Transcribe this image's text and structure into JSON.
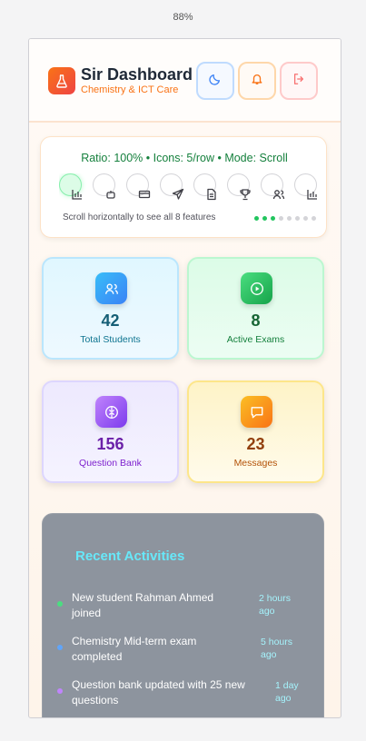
{
  "zoom": "88%",
  "header": {
    "title": "Sir Dashboard",
    "subtitle": "Chemistry & ICT Care",
    "buttons": [
      {
        "name": "theme-toggle",
        "icon": "moon-icon"
      },
      {
        "name": "notifications",
        "icon": "bell-icon"
      },
      {
        "name": "logout",
        "icon": "logout-icon"
      }
    ]
  },
  "features": {
    "status": "Ratio: 100% • Icons: 5/row • Mode: Scroll",
    "hint": "Scroll horizontally to see all 8 features",
    "icons": [
      "chart-icon",
      "robot-icon",
      "card-icon",
      "send-icon",
      "document-icon",
      "trophy-icon",
      "users-icon",
      "chart-icon"
    ],
    "active_index": 0,
    "pagination": {
      "total": 8,
      "active": 3
    }
  },
  "stats": [
    {
      "value": "42",
      "label": "Total Students",
      "icon": "users-icon",
      "color": "#0e7490"
    },
    {
      "value": "8",
      "label": "Active Exams",
      "icon": "play-icon",
      "color": "#15803d"
    },
    {
      "value": "156",
      "label": "Question Bank",
      "icon": "brain-icon",
      "color": "#7e22ce"
    },
    {
      "value": "23",
      "label": "Messages",
      "icon": "message-icon",
      "color": "#b45309"
    }
  ],
  "activities": {
    "title": "Recent Activities",
    "items": [
      {
        "text": "New student Rahman Ahmed joined",
        "time": "2 hours ago",
        "color": "#4ade80"
      },
      {
        "text": "Chemistry Mid-term exam completed",
        "time": "5 hours ago",
        "color": "#60a5fa"
      },
      {
        "text": "Question bank updated with 25 new questions",
        "time": "1 day ago",
        "color": "#c084fc"
      }
    ]
  }
}
